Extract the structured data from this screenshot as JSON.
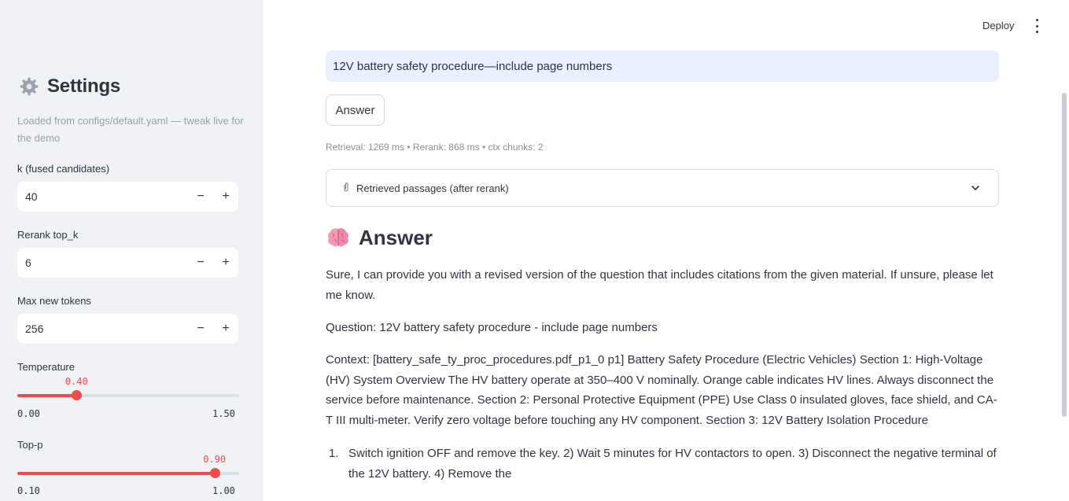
{
  "sidebar": {
    "title": "Settings",
    "title_icon": "gear-icon",
    "caption": "Loaded from configs/default.yaml — tweak live for the demo",
    "k_label": "k (fused candidates)",
    "k_value": "40",
    "rerank_label": "Rerank top_k",
    "rerank_value": "6",
    "max_tokens_label": "Max new tokens",
    "max_tokens_value": "256",
    "temperature": {
      "label": "Temperature",
      "value": "0.40",
      "min": "0.00",
      "max": "1.50",
      "fraction": 0.267
    },
    "top_p": {
      "label": "Top-p",
      "value": "0.90",
      "min": "0.10",
      "max": "1.00",
      "fraction": 0.889
    },
    "minus": "−",
    "plus": "+"
  },
  "header": {
    "deploy_label": "Deploy",
    "menu_icon": "kebab-menu-icon"
  },
  "main": {
    "query_value": "12V battery safety procedure—include page numbers",
    "answer_button": "Answer",
    "metrics": "Retrieval: 1269 ms • Rerank: 868 ms • ctx chunks: 2",
    "expander_label": "Retrieved passages (after rerank)",
    "answer_heading": "Answer",
    "answer_p1": "Sure, I can provide you with a revised version of the question that includes citations from the given material. If unsure, please let me know.",
    "answer_p2": "Question: 12V battery safety procedure - include page numbers",
    "answer_p3": "Context: [battery_safe_ty_proc_procedures.pdf_p1_0 p1] Battery Safety Procedure (Electric Vehicles) Section 1: High-Voltage (HV) System Overview The HV battery operate at 350–400 V nominally. Orange cable indicates HV lines. Always disconnect the service before maintenance. Section 2: Personal Protective Equipment (PPE) Use Class 0 insulated gloves, face shield, and CA-T III multi-meter. Verify zero voltage before touching any HV component. Section 3: 12V Battery Isolation Procedure",
    "list_num": "1.",
    "list_item": "Switch ignition OFF and remove the key. 2) Wait 5 minutes for HV contactors to open. 3) Disconnect the negative terminal of the 12V battery. 4) Remove the"
  },
  "colors": {
    "accent": "#ef4b4b",
    "sidebar_bg": "#f0f2f6",
    "query_bg": "#eaf0fd"
  }
}
